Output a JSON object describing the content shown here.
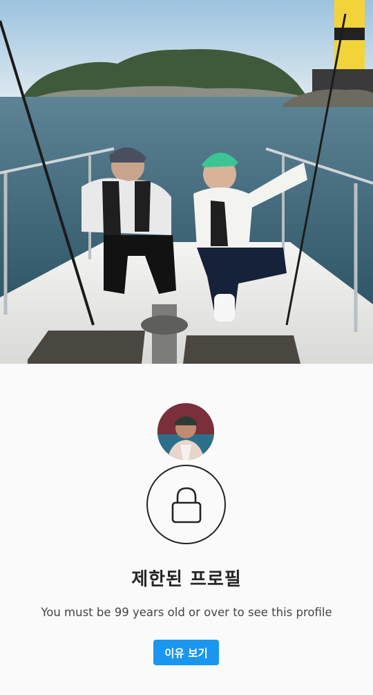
{
  "profile": {
    "title": "제한된 프로필",
    "message": "You must be 99 years old or over to see this profile",
    "reason_button_label": "이유 보기"
  },
  "icons": {
    "lock": "lock-icon"
  },
  "colors": {
    "background": "#fafafa",
    "accent": "#1a95f0",
    "title_text": "#262626",
    "body_text": "#444444"
  }
}
